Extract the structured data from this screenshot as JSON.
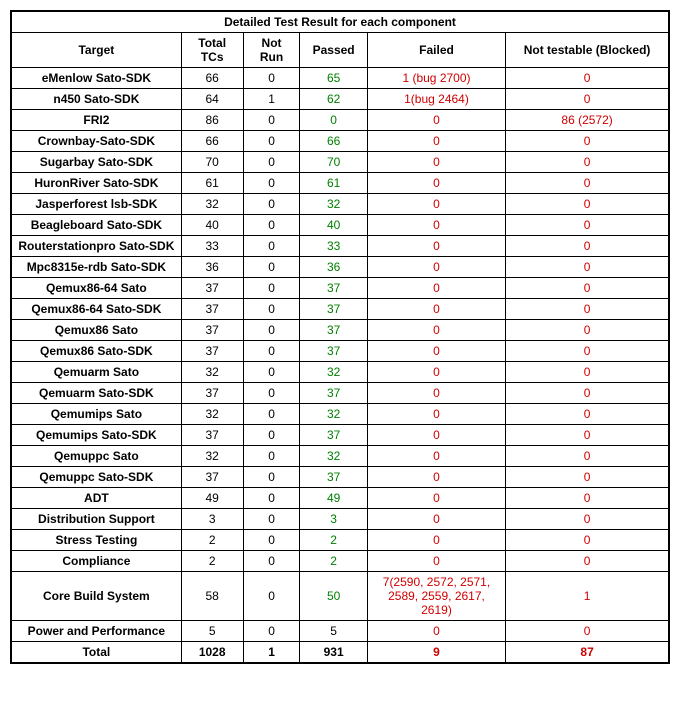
{
  "table": {
    "title": "Detailed Test Result for each component",
    "headers": {
      "target": "Target",
      "total_tcs": "Total TCs",
      "not_run": "Not Run",
      "passed": "Passed",
      "failed": "Failed",
      "blocked": "Not testable (Blocked)"
    },
    "rows": [
      {
        "target": "eMenlow Sato-SDK",
        "tcs": "66",
        "notrun": "0",
        "passed": "65",
        "failed": "1 (bug 2700)",
        "blocked": "0"
      },
      {
        "target": "n450 Sato-SDK",
        "tcs": "64",
        "notrun": "1",
        "passed": "62",
        "failed": "1(bug 2464)",
        "blocked": "0"
      },
      {
        "target": "FRI2",
        "tcs": "86",
        "notrun": "0",
        "passed": "0",
        "failed": "0",
        "blocked": "86 (2572)"
      },
      {
        "target": "Crownbay-Sato-SDK",
        "tcs": "66",
        "notrun": "0",
        "passed": "66",
        "failed": "0",
        "blocked": "0"
      },
      {
        "target": "Sugarbay Sato-SDK",
        "tcs": "70",
        "notrun": "0",
        "passed": "70",
        "failed": "0",
        "blocked": "0"
      },
      {
        "target": "HuronRiver Sato-SDK",
        "tcs": "61",
        "notrun": "0",
        "passed": "61",
        "failed": "0",
        "blocked": "0"
      },
      {
        "target": "Jasperforest lsb-SDK",
        "tcs": "32",
        "notrun": "0",
        "passed": "32",
        "failed": "0",
        "blocked": "0"
      },
      {
        "target": "Beagleboard Sato-SDK",
        "tcs": "40",
        "notrun": "0",
        "passed": "40",
        "failed": "0",
        "blocked": "0"
      },
      {
        "target": "Routerstationpro Sato-SDK",
        "tcs": "33",
        "notrun": "0",
        "passed": "33",
        "failed": "0",
        "blocked": "0"
      },
      {
        "target": "Mpc8315e-rdb Sato-SDK",
        "tcs": "36",
        "notrun": "0",
        "passed": "36",
        "failed": "0",
        "blocked": "0"
      },
      {
        "target": "Qemux86-64 Sato",
        "tcs": "37",
        "notrun": "0",
        "passed": "37",
        "failed": "0",
        "blocked": "0"
      },
      {
        "target": "Qemux86-64 Sato-SDK",
        "tcs": "37",
        "notrun": "0",
        "passed": "37",
        "failed": "0",
        "blocked": "0"
      },
      {
        "target": "Qemux86 Sato",
        "tcs": "37",
        "notrun": "0",
        "passed": "37",
        "failed": "0",
        "blocked": "0"
      },
      {
        "target": "Qemux86 Sato-SDK",
        "tcs": "37",
        "notrun": "0",
        "passed": "37",
        "failed": "0",
        "blocked": "0"
      },
      {
        "target": "Qemuarm Sato",
        "tcs": "32",
        "notrun": "0",
        "passed": "32",
        "failed": "0",
        "blocked": "0"
      },
      {
        "target": "Qemuarm Sato-SDK",
        "tcs": "37",
        "notrun": "0",
        "passed": "37",
        "failed": "0",
        "blocked": "0"
      },
      {
        "target": "Qemumips Sato",
        "tcs": "32",
        "notrun": "0",
        "passed": "32",
        "failed": "0",
        "blocked": "0"
      },
      {
        "target": "Qemumips Sato-SDK",
        "tcs": "37",
        "notrun": "0",
        "passed": "37",
        "failed": "0",
        "blocked": "0"
      },
      {
        "target": "Qemuppc Sato",
        "tcs": "32",
        "notrun": "0",
        "passed": "32",
        "failed": "0",
        "blocked": "0"
      },
      {
        "target": "Qemuppc Sato-SDK",
        "tcs": "37",
        "notrun": "0",
        "passed": "37",
        "failed": "0",
        "blocked": "0"
      },
      {
        "target": "ADT",
        "tcs": "49",
        "notrun": "0",
        "passed": "49",
        "failed": "0",
        "blocked": "0"
      },
      {
        "target": "Distribution Support",
        "tcs": "3",
        "notrun": "0",
        "passed": "3",
        "failed": "0",
        "blocked": "0"
      },
      {
        "target": "Stress Testing",
        "tcs": "2",
        "notrun": "0",
        "passed": "2",
        "failed": "0",
        "blocked": "0"
      },
      {
        "target": "Compliance",
        "tcs": "2",
        "notrun": "0",
        "passed": "2",
        "failed": "0",
        "blocked": "0"
      },
      {
        "target": "Core Build System",
        "tcs": "58",
        "notrun": "0",
        "passed": "50",
        "failed": "7(2590, 2572, 2571, 2589, 2559, 2617, 2619)",
        "blocked": "1"
      },
      {
        "target": "Power and Performance",
        "tcs": "5",
        "notrun": "0",
        "passed": "5",
        "failed": "0",
        "blocked": "0",
        "passed_black": true
      }
    ],
    "total": {
      "label": "Total",
      "tcs": "1028",
      "notrun": "1",
      "passed": "931",
      "failed": "9",
      "blocked": "87"
    }
  }
}
